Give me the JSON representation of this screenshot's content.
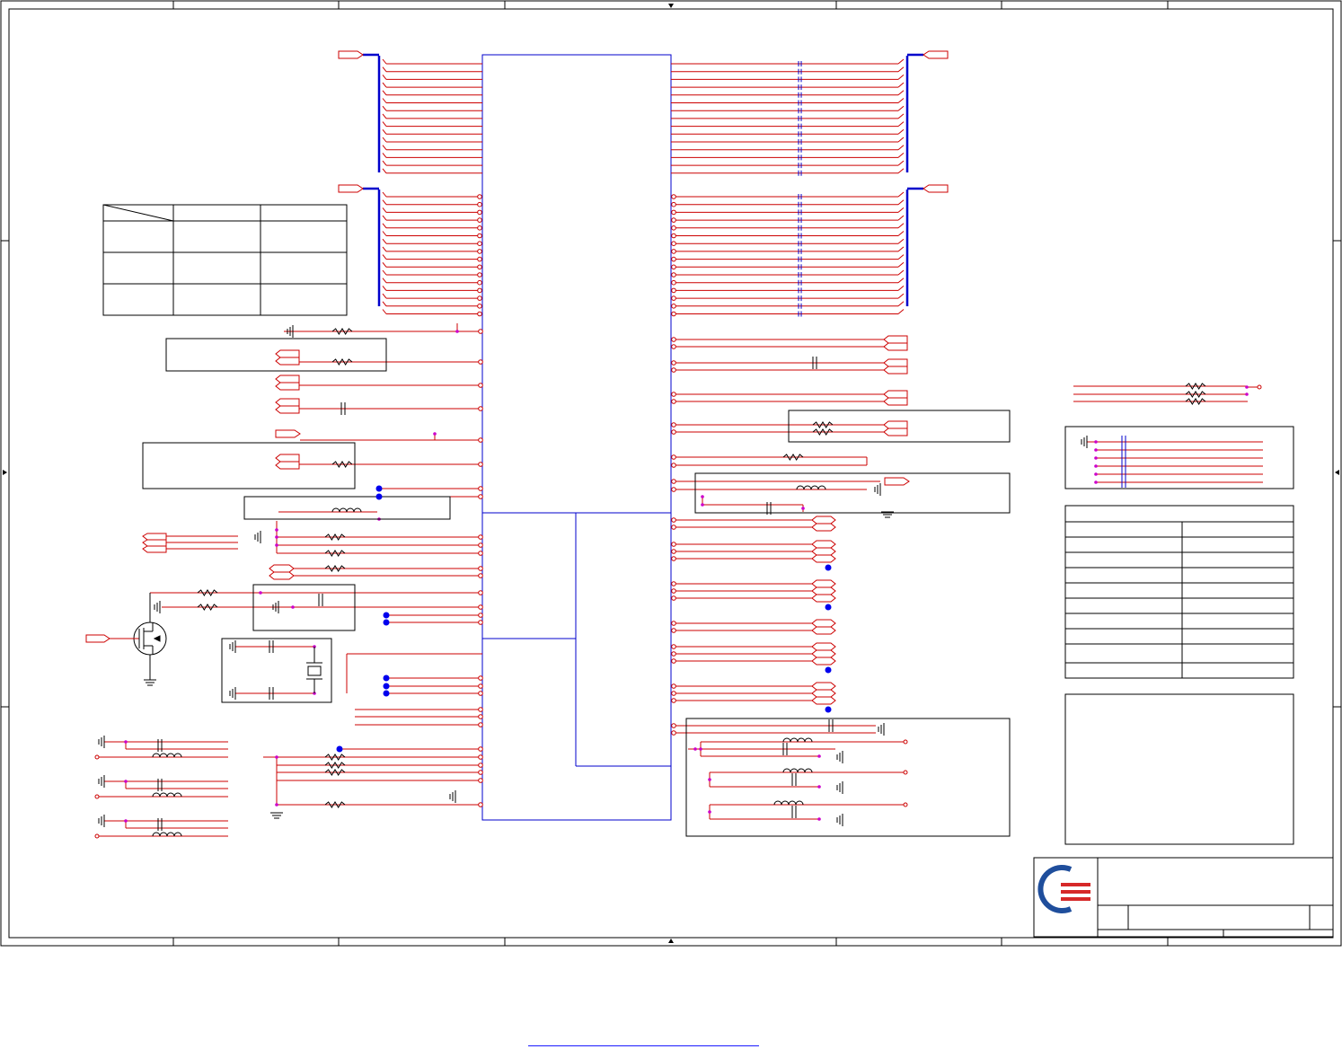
{
  "colors": {
    "frame": "#000000",
    "net": "#cc0000",
    "bus": "#0000cc",
    "chip": "#0000cc",
    "junction_dot": "#0000ee",
    "magenta_node": "#cc00cc",
    "logo_blue": "#1f4e9c",
    "logo_red": "#d62828",
    "link": "#1a1aff"
  },
  "icons": {
    "logo": "company-logo-icon",
    "mosfet": "mosfet-icon",
    "crystal": "crystal-icon",
    "ground": "ground-icon",
    "resistor": "resistor-icon",
    "capacitor": "capacitor-icon",
    "inductor": "inductor-icon",
    "port": "off-page-connector-icon"
  },
  "texts": {}
}
